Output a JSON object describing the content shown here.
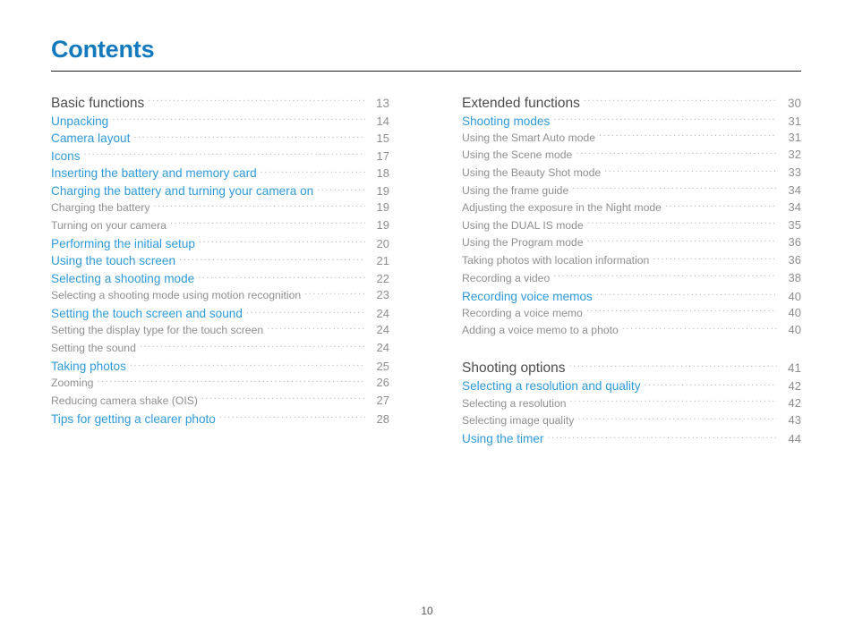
{
  "document": {
    "title": "Contents",
    "folio": "10",
    "colors": {
      "title_blue": "#1379bd",
      "entry_blue": "#2e9ada",
      "section_dark": "#4d4d4d",
      "sub_gray": "#8f8f8f",
      "leader_gray": "#b9b9b9",
      "rule_black": "#231f20"
    }
  },
  "columns": {
    "left": {
      "groups": [
        {
          "entries": [
            {
              "level": "section",
              "label": "Basic functions",
              "page": "13"
            },
            {
              "level": "main",
              "label": "Unpacking",
              "page": "14"
            },
            {
              "level": "main",
              "label": "Camera layout",
              "page": "15"
            },
            {
              "level": "main",
              "label": "Icons",
              "page": "17"
            },
            {
              "level": "main",
              "label": "Inserting the battery and memory card",
              "page": "18"
            },
            {
              "level": "main",
              "label": "Charging the battery and turning your camera on",
              "page": "19"
            },
            {
              "level": "sub",
              "label": "Charging the battery",
              "page": "19"
            },
            {
              "level": "sub",
              "label": "Turning on your camera",
              "page": "19"
            },
            {
              "level": "main",
              "label": "Performing the initial setup",
              "page": "20"
            },
            {
              "level": "main",
              "label": "Using the touch screen",
              "page": "21"
            },
            {
              "level": "main",
              "label": "Selecting a shooting mode",
              "page": "22"
            },
            {
              "level": "sub",
              "label": "Selecting a shooting mode using motion recognition",
              "page": "23"
            },
            {
              "level": "main",
              "label": "Setting the touch screen and sound",
              "page": "24"
            },
            {
              "level": "sub",
              "label": "Setting the display type for the touch screen",
              "page": "24"
            },
            {
              "level": "sub",
              "label": "Setting the sound",
              "page": "24"
            },
            {
              "level": "main",
              "label": "Taking photos",
              "page": "25"
            },
            {
              "level": "sub",
              "label": "Zooming",
              "page": "26"
            },
            {
              "level": "sub",
              "label": "Reducing camera shake (OIS)",
              "page": "27"
            },
            {
              "level": "main",
              "label": "Tips for getting a clearer photo",
              "page": "28"
            }
          ]
        }
      ]
    },
    "right": {
      "groups": [
        {
          "entries": [
            {
              "level": "section",
              "label": "Extended functions",
              "page": "30"
            },
            {
              "level": "main",
              "label": "Shooting modes",
              "page": "31"
            },
            {
              "level": "sub",
              "label": "Using the Smart Auto mode",
              "page": "31"
            },
            {
              "level": "sub",
              "label": "Using the Scene mode",
              "page": "32"
            },
            {
              "level": "sub",
              "label": "Using the Beauty Shot mode",
              "page": "33"
            },
            {
              "level": "sub",
              "label": "Using the frame guide",
              "page": "34"
            },
            {
              "level": "sub",
              "label": "Adjusting the exposure in the Night mode",
              "page": "34"
            },
            {
              "level": "sub",
              "label": "Using the DUAL IS mode",
              "page": "35"
            },
            {
              "level": "sub",
              "label": "Using the Program mode",
              "page": "36"
            },
            {
              "level": "sub",
              "label": "Taking photos with location information",
              "page": "36"
            },
            {
              "level": "sub",
              "label": "Recording a video",
              "page": "38"
            },
            {
              "level": "main",
              "label": "Recording voice memos",
              "page": "40"
            },
            {
              "level": "sub",
              "label": "Recording a voice memo",
              "page": "40"
            },
            {
              "level": "sub",
              "label": "Adding a voice memo to a photo",
              "page": "40"
            }
          ]
        },
        {
          "entries": [
            {
              "level": "section",
              "label": "Shooting options",
              "page": "41"
            },
            {
              "level": "main",
              "label": "Selecting a resolution and quality",
              "page": "42"
            },
            {
              "level": "sub",
              "label": "Selecting a resolution",
              "page": "42"
            },
            {
              "level": "sub",
              "label": "Selecting image quality",
              "page": "43"
            },
            {
              "level": "main",
              "label": "Using the timer",
              "page": "44"
            }
          ]
        }
      ]
    }
  }
}
